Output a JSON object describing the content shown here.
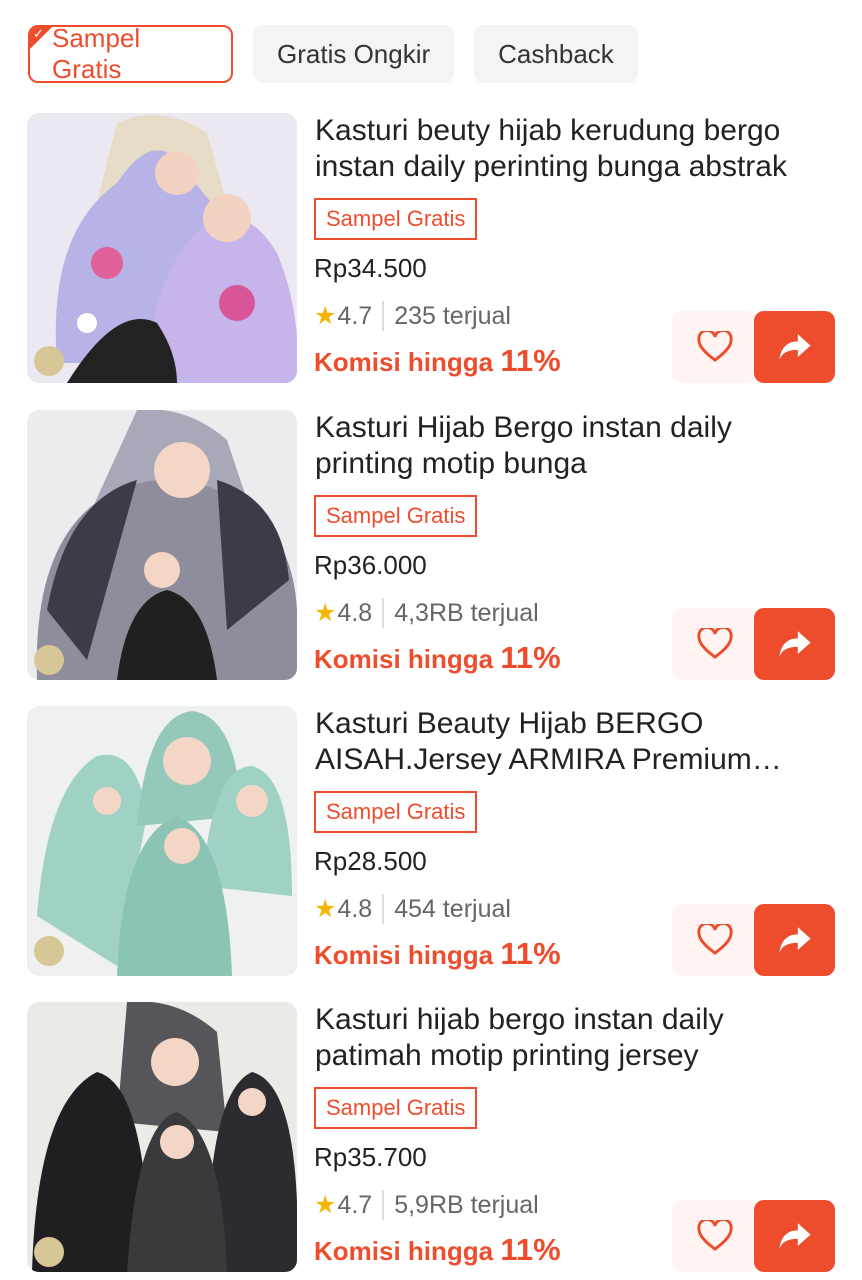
{
  "filters": [
    {
      "label": "Sampel Gratis",
      "active": true
    },
    {
      "label": "Gratis Ongkir",
      "active": false
    },
    {
      "label": "Cashback",
      "active": false
    }
  ],
  "products": [
    {
      "title": "Kasturi beuty hijab kerudung bergo instan daily perinting bunga abstrak",
      "badge": "Sampel Gratis",
      "price": "Rp34.500",
      "rating": "4.7",
      "sold": "235 terjual",
      "commission_label": "Komisi hingga",
      "commission_value": "11%",
      "image_color": "#b8b3e6"
    },
    {
      "title": "Kasturi Hijab Bergo instan daily printing motip bunga",
      "badge": "Sampel Gratis",
      "price": "Rp36.000",
      "rating": "4.8",
      "sold": "4,3RB terjual",
      "commission_label": "Komisi hingga",
      "commission_value": "11%",
      "image_color": "#9a9aa6"
    },
    {
      "title": "Kasturi Beauty Hijab BERGO AISAH.Jersey ARMIRA Premium Siz...",
      "badge": "Sampel Gratis",
      "price": "Rp28.500",
      "rating": "4.8",
      "sold": "454 terjual",
      "commission_label": "Komisi hingga",
      "commission_value": "11%",
      "image_color": "#9fd1c4"
    },
    {
      "title": "Kasturi hijab bergo instan daily patimah motip printing jersey",
      "badge": "Sampel Gratis",
      "price": "Rp35.700",
      "rating": "4.7",
      "sold": "5,9RB terjual",
      "commission_label": "Komisi hingga",
      "commission_value": "11%",
      "image_color": "#3a3a3c"
    }
  ],
  "accent_color": "#ee4d2d",
  "icons": {
    "favorite": "heart-outline-icon",
    "share": "share-arrow-icon",
    "rating": "star-icon"
  }
}
